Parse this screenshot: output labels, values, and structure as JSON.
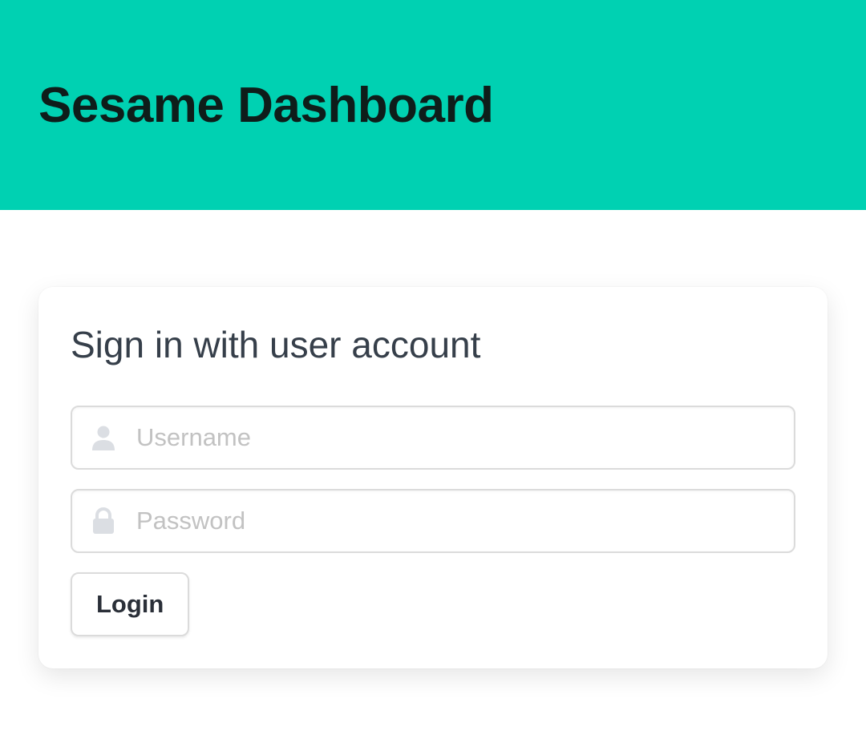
{
  "header": {
    "title": "Sesame Dashboard",
    "background_color": "#00d1b2"
  },
  "login_card": {
    "title": "Sign in with user account",
    "username": {
      "icon": "user-icon",
      "placeholder": "Username",
      "value": ""
    },
    "password": {
      "icon": "lock-icon",
      "placeholder": "Password",
      "value": ""
    },
    "login_button_label": "Login"
  }
}
